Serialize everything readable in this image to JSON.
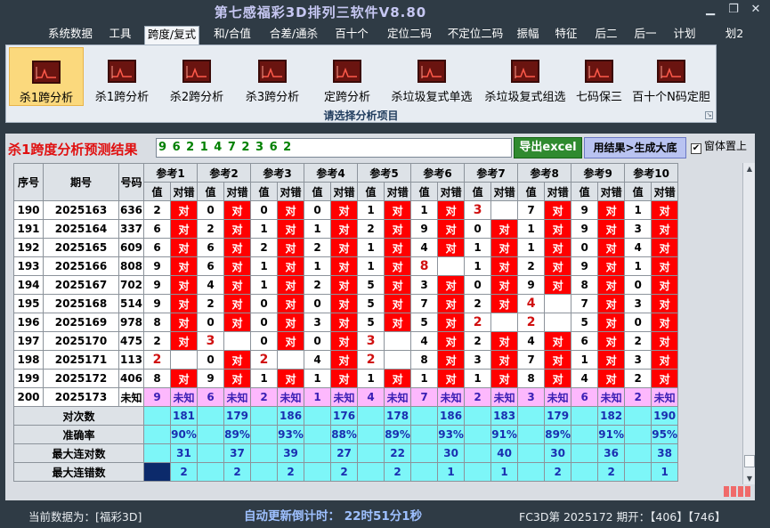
{
  "app": {
    "title": "第七感福彩3D排列三软件V8.80",
    "right_fragment": "划2"
  },
  "menu": [
    "系统数据",
    "工具",
    "跨度/复式",
    "和/合值",
    "合差/通杀",
    "百十个",
    "定位二码",
    "不定位二码",
    "振幅",
    "特征",
    "后二",
    "后一",
    "计划"
  ],
  "ribbon": {
    "buttons": [
      "杀1跨分析",
      "杀1跨分析",
      "杀2跨分析",
      "杀3跨分析",
      "定跨分析",
      "杀垃圾复式单选",
      "杀垃圾复式组选",
      "七码保三",
      "百十个N码定胆"
    ],
    "caption": "请选择分析项目",
    "icon": "chart-icon"
  },
  "result": {
    "label": "杀1跨度分析预测结果",
    "value": "9 6 2 1 4 7 2 3 6 2",
    "export_label": "导出excel",
    "make_label": "用结果>生成大底",
    "topmost_label": "窗体置上",
    "topmost_checked": true
  },
  "table": {
    "headers": {
      "seq": "序号",
      "period": "期号",
      "number": "号码",
      "ref": [
        "参考1",
        "参考2",
        "参考3",
        "参考4",
        "参考5",
        "参考6",
        "参考7",
        "参考8",
        "参考9",
        "参考10"
      ],
      "val": "值",
      "result": "对错"
    },
    "ok_text": "对",
    "unknown_text": "未知",
    "rows": [
      {
        "seq": "190",
        "period": "2025163",
        "num": "636",
        "vals": [
          "2",
          "0",
          "0",
          "0",
          "1",
          "1",
          "3",
          "7",
          "9",
          "1"
        ],
        "ok": [
          1,
          1,
          1,
          1,
          1,
          1,
          0,
          1,
          1,
          1
        ]
      },
      {
        "seq": "191",
        "period": "2025164",
        "num": "337",
        "vals": [
          "6",
          "2",
          "1",
          "1",
          "2",
          "9",
          "0",
          "1",
          "9",
          "3"
        ],
        "ok": [
          1,
          1,
          1,
          1,
          1,
          1,
          1,
          1,
          1,
          1
        ]
      },
      {
        "seq": "192",
        "period": "2025165",
        "num": "609",
        "vals": [
          "6",
          "6",
          "2",
          "2",
          "1",
          "4",
          "1",
          "1",
          "0",
          "4"
        ],
        "ok": [
          1,
          1,
          1,
          1,
          1,
          1,
          1,
          1,
          1,
          1
        ]
      },
      {
        "seq": "193",
        "period": "2025166",
        "num": "808",
        "vals": [
          "9",
          "6",
          "1",
          "1",
          "1",
          "8",
          "1",
          "2",
          "9",
          "1"
        ],
        "ok": [
          1,
          1,
          1,
          1,
          1,
          0,
          1,
          1,
          1,
          1
        ]
      },
      {
        "seq": "194",
        "period": "2025167",
        "num": "702",
        "vals": [
          "9",
          "4",
          "1",
          "2",
          "5",
          "3",
          "0",
          "9",
          "8",
          "0"
        ],
        "ok": [
          1,
          1,
          1,
          1,
          1,
          1,
          1,
          1,
          1,
          1
        ]
      },
      {
        "seq": "195",
        "period": "2025168",
        "num": "514",
        "vals": [
          "9",
          "2",
          "0",
          "0",
          "5",
          "7",
          "2",
          "4",
          "7",
          "3"
        ],
        "ok": [
          1,
          1,
          1,
          1,
          1,
          1,
          1,
          0,
          1,
          1
        ]
      },
      {
        "seq": "196",
        "period": "2025169",
        "num": "978",
        "vals": [
          "8",
          "0",
          "0",
          "3",
          "5",
          "5",
          "2",
          "2",
          "5",
          "0"
        ],
        "ok": [
          1,
          1,
          1,
          1,
          1,
          1,
          0,
          0,
          1,
          1
        ]
      },
      {
        "seq": "197",
        "period": "2025170",
        "num": "475",
        "vals": [
          "2",
          "3",
          "0",
          "0",
          "3",
          "4",
          "2",
          "4",
          "6",
          "2"
        ],
        "ok": [
          1,
          0,
          1,
          1,
          0,
          1,
          1,
          1,
          1,
          1
        ]
      },
      {
        "seq": "198",
        "period": "2025171",
        "num": "113",
        "vals": [
          "2",
          "0",
          "2",
          "4",
          "2",
          "8",
          "3",
          "7",
          "1",
          "3"
        ],
        "ok": [
          0,
          1,
          0,
          1,
          0,
          1,
          1,
          1,
          1,
          1
        ]
      },
      {
        "seq": "199",
        "period": "2025172",
        "num": "406",
        "vals": [
          "8",
          "9",
          "1",
          "1",
          "1",
          "1",
          "1",
          "8",
          "4",
          "2"
        ],
        "ok": [
          1,
          1,
          1,
          1,
          1,
          1,
          1,
          1,
          1,
          1
        ]
      }
    ],
    "red_vals": [
      [
        0,
        6
      ],
      [
        3,
        5
      ],
      [
        6,
        6
      ],
      [
        6,
        7
      ],
      [
        7,
        1
      ],
      [
        7,
        4
      ],
      [
        8,
        0
      ],
      [
        8,
        2
      ],
      [
        8,
        4
      ],
      [
        5,
        7
      ]
    ],
    "pending": {
      "seq": "200",
      "period": "2025173",
      "num": "未知",
      "vals": [
        "9",
        "6",
        "2",
        "1",
        "4",
        "7",
        "2",
        "3",
        "6",
        "2"
      ]
    },
    "stats": [
      {
        "label": "对次数",
        "values": [
          "181",
          "179",
          "186",
          "176",
          "178",
          "186",
          "183",
          "179",
          "182",
          "190"
        ]
      },
      {
        "label": "准确率",
        "values": [
          "90%",
          "89%",
          "93%",
          "88%",
          "89%",
          "93%",
          "91%",
          "89%",
          "91%",
          "95%"
        ]
      },
      {
        "label": "最大连对数",
        "values": [
          "31",
          "37",
          "39",
          "27",
          "22",
          "30",
          "40",
          "30",
          "36",
          "38"
        ]
      },
      {
        "label": "最大连错数",
        "values": [
          "2",
          "2",
          "2",
          "2",
          "2",
          "1",
          "1",
          "2",
          "2",
          "1"
        ]
      }
    ]
  },
  "status": {
    "current_data": "当前数据为：[福彩3D]",
    "countdown": "自动更新倒计时： 22时51分1秒",
    "draw": "FC3D第 2025172 期开：【406】【746】"
  },
  "colors": {
    "correct": "#ff0000",
    "pending": "#fdb8fd",
    "stats": "#7df6f8",
    "accent": "#2f8a2f"
  }
}
